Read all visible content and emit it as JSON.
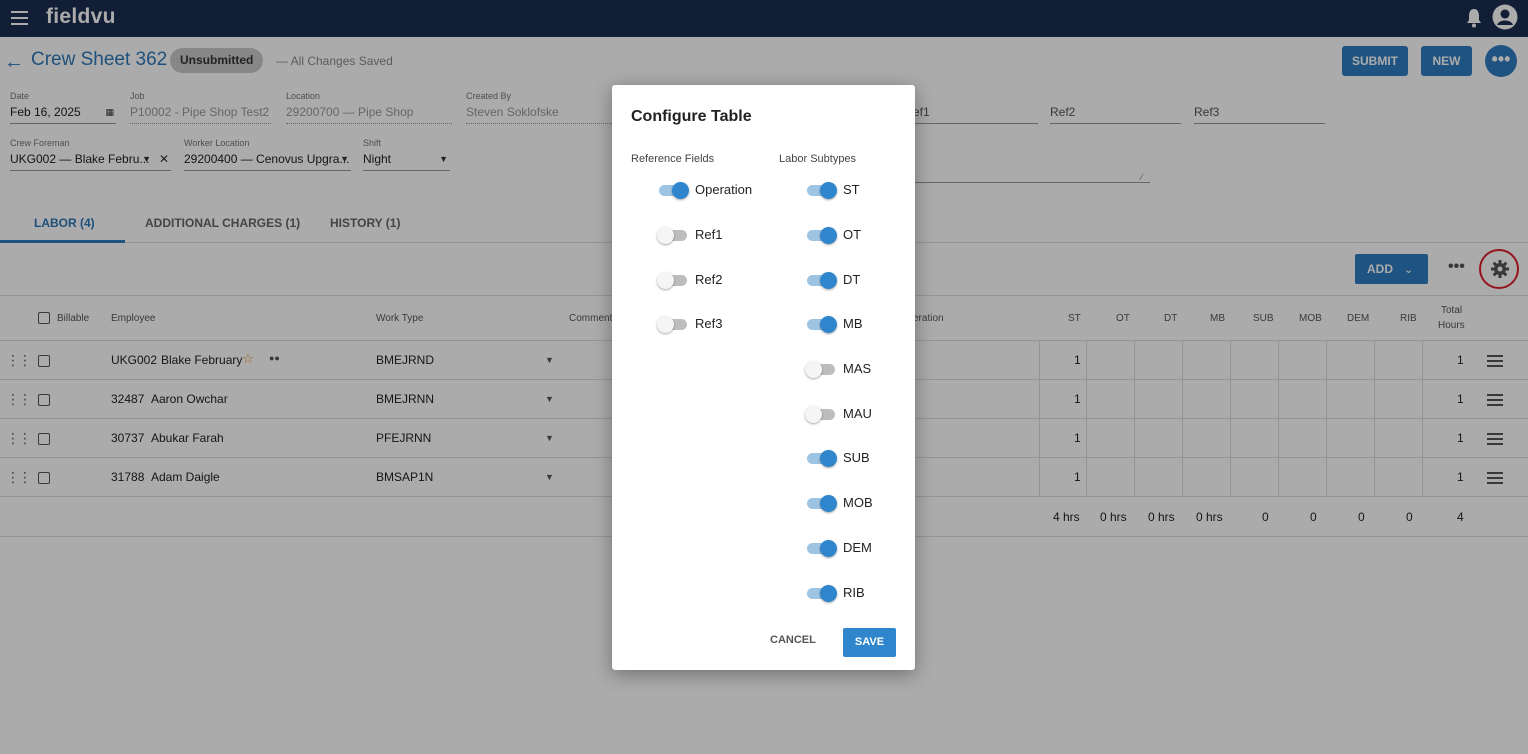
{
  "app": {
    "brand": "fieldvu"
  },
  "header": {
    "title": "Crew Sheet 362",
    "status": "Unsubmitted",
    "saved_text": "— All Changes Saved",
    "submit_label": "SUBMIT",
    "new_label": "NEW",
    "more_label": "•••"
  },
  "form": {
    "date": {
      "label": "Date",
      "value": "Feb 16, 2025"
    },
    "job": {
      "label": "Job",
      "value": "P10002 - Pipe Shop Test2"
    },
    "location": {
      "label": "Location",
      "value": "29200700 — Pipe Shop"
    },
    "created_by": {
      "label": "Created By",
      "value": "Steven Soklofske"
    },
    "ref1": {
      "value": "ef1"
    },
    "ref2": {
      "value": "Ref2"
    },
    "ref3": {
      "value": "Ref3"
    },
    "crew_foreman": {
      "label": "Crew Foreman",
      "value": "UKG002 — Blake Febru..."
    },
    "worker_location": {
      "label": "Worker Location",
      "value": "29200400 — Cenovus Upgra..."
    },
    "shift": {
      "label": "Shift",
      "value": "Night"
    }
  },
  "tabs": [
    {
      "label": "LABOR  (4)"
    },
    {
      "label": "ADDITIONAL CHARGES (1)"
    },
    {
      "label": "HISTORY (1)"
    }
  ],
  "toolbar": {
    "add_label": "ADD",
    "more": "•••"
  },
  "table": {
    "headers": {
      "billable": "Billable",
      "employee": "Employee",
      "work_type": "Work Type",
      "comment": "Comment",
      "operation": "eration",
      "st": "ST",
      "ot": "OT",
      "dt": "DT",
      "mb": "MB",
      "sub": "SUB",
      "mob": "MOB",
      "dem": "DEM",
      "rib": "RIB",
      "total_1": "Total",
      "total_2": "Hours"
    },
    "rows": [
      {
        "id": "UKG002",
        "name": "Blake February",
        "work_type": "BMEJRND",
        "st": "1",
        "total": "1"
      },
      {
        "id": "32487",
        "name": "Aaron Owchar",
        "work_type": "BMEJRNN",
        "st": "1",
        "total": "1"
      },
      {
        "id": "30737",
        "name": "Abukar Farah",
        "work_type": "PFEJRNN",
        "st": "1",
        "total": "1"
      },
      {
        "id": "31788",
        "name": "Adam Daigle",
        "work_type": "BMSAP1N",
        "st": "1",
        "total": "1"
      }
    ],
    "totals": {
      "st": "4  hrs",
      "ot": "0  hrs",
      "dt": "0  hrs",
      "mb": "0  hrs",
      "sub": "0",
      "mob": "0",
      "dem": "0",
      "rib": "0",
      "total": "4"
    }
  },
  "dialog": {
    "title": "Configure Table",
    "ref_header": "Reference Fields",
    "labor_header": "Labor Subtypes",
    "ref_fields": [
      {
        "label": "Operation",
        "on": true
      },
      {
        "label": "Ref1",
        "on": false
      },
      {
        "label": "Ref2",
        "on": false
      },
      {
        "label": "Ref3",
        "on": false
      }
    ],
    "labor_subtypes": [
      {
        "label": "ST",
        "on": true
      },
      {
        "label": "OT",
        "on": true
      },
      {
        "label": "DT",
        "on": true
      },
      {
        "label": "MB",
        "on": true
      },
      {
        "label": "MAS",
        "on": false
      },
      {
        "label": "MAU",
        "on": false
      },
      {
        "label": "SUB",
        "on": true
      },
      {
        "label": "MOB",
        "on": true
      },
      {
        "label": "DEM",
        "on": true
      },
      {
        "label": "RIB",
        "on": true
      }
    ],
    "cancel_label": "CANCEL",
    "save_label": "SAVE"
  },
  "colors": {
    "navbar": "#1c2e4f",
    "primary": "#2f7dc0",
    "highlight": "#e0202a"
  }
}
